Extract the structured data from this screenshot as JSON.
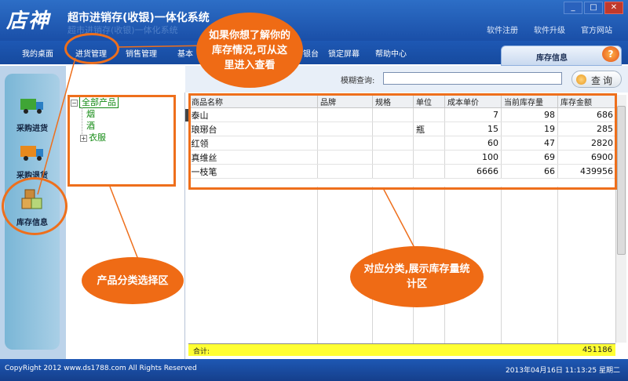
{
  "app": {
    "logo": "店神",
    "title": "超市进销存(收银)一体化系统",
    "title_shadow": "超市进销存(收银)一体化系统"
  },
  "window": {
    "min": "_",
    "restore": "□",
    "close": "✕"
  },
  "top_links": [
    "软件注册",
    "软件升级",
    "官方网站"
  ],
  "menu": [
    "我的桌面",
    "进货管理",
    "销售管理",
    "基本",
    "银台",
    "锁定屏幕",
    "帮助中心"
  ],
  "panel_tab": {
    "label": "库存信息",
    "help": "?"
  },
  "search": {
    "label": "模糊查询:",
    "value": "",
    "button": "查询"
  },
  "sidebar": {
    "items": [
      {
        "label": "采购进货",
        "icon": "truck-green-icon"
      },
      {
        "label": "采购退货",
        "icon": "truck-orange-icon"
      },
      {
        "label": "库存信息",
        "icon": "boxes-icon"
      }
    ]
  },
  "tree": {
    "root": "全部产品",
    "children": [
      {
        "label": "烟",
        "expander": ""
      },
      {
        "label": "酒",
        "expander": ""
      },
      {
        "label": "衣服",
        "expander": "+"
      }
    ]
  },
  "grid": {
    "columns": [
      "商品名称",
      "品牌",
      "规格",
      "单位",
      "成本单价",
      "当前库存量",
      "库存金额"
    ],
    "rows": [
      [
        "泰山",
        "",
        "",
        "",
        "7",
        "98",
        "686"
      ],
      [
        "琅琊台",
        "",
        "",
        "瓶",
        "15",
        "19",
        "285"
      ],
      [
        "红领",
        "",
        "",
        "",
        "60",
        "47",
        "2820"
      ],
      [
        "真维丝",
        "",
        "",
        "",
        "100",
        "69",
        "6900"
      ],
      [
        "一枝笔",
        "",
        "",
        "",
        "6666",
        "66",
        "439956"
      ]
    ],
    "total_label": "合计:",
    "total_value": "451186"
  },
  "status": {
    "copyright": "CopyRight 2012  www.ds1788.com   All Rights Reserved",
    "datetime": "2013年04月16日  11:13:25 星期二"
  },
  "annotations": {
    "top": "如果你想了解你的库存情况,可从这里进入查看",
    "category": "产品分类选择区",
    "stock": "对应分类,展示库存量统计区"
  },
  "colors": {
    "accent": "#ee6f1c",
    "titlebar": "#1a4fa8",
    "total_row": "#ffff33",
    "tree_text": "#138a13"
  }
}
